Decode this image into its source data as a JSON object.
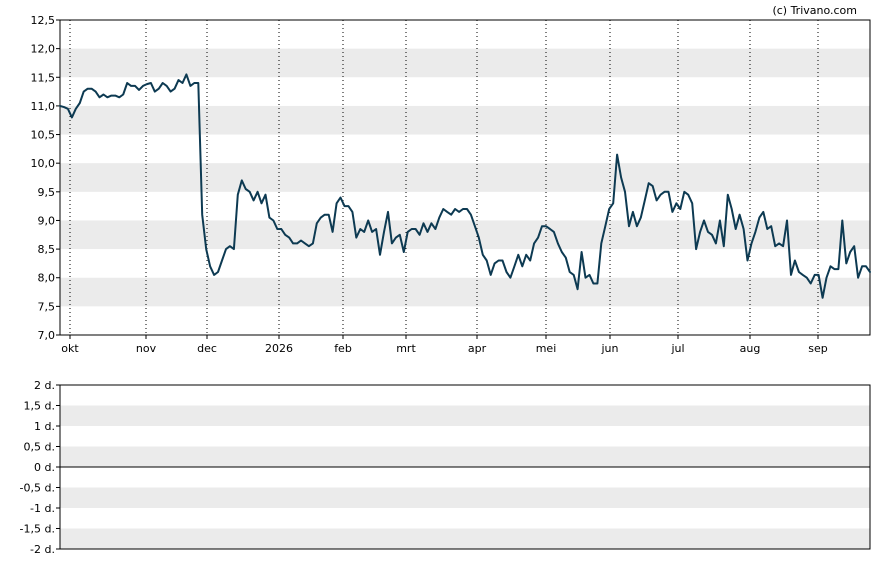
{
  "copyright": "(c) Trivano.com",
  "chart_data": [
    {
      "type": "line",
      "grid": "alternating horizontal bands with dotted vertical month lines",
      "ylim": [
        7.0,
        12.5
      ],
      "yticks": [
        "12,5",
        "12,0",
        "11,5",
        "11,0",
        "10,5",
        "10,0",
        "9,5",
        "9,0",
        "8,5",
        "8,0",
        "7,5",
        "7,0"
      ],
      "xticks": [
        "okt",
        "nov",
        "dec",
        "2026",
        "feb",
        "mrt",
        "apr",
        "mei",
        "jun",
        "jul",
        "aug",
        "sep"
      ],
      "line_color": "#0d3a52",
      "series": [
        {
          "values": [
            11.0,
            10.98,
            10.95,
            10.8,
            10.95,
            11.05,
            11.25,
            11.3,
            11.3,
            11.25,
            11.15,
            11.2,
            11.15,
            11.18,
            11.18,
            11.15,
            11.2,
            11.4,
            11.35,
            11.35,
            11.28,
            11.35,
            11.38,
            11.4,
            11.25,
            11.3,
            11.4,
            11.35,
            11.25,
            11.3,
            11.45,
            11.4,
            11.55,
            11.35,
            11.4,
            11.4,
            9.1,
            8.5,
            8.2,
            8.05,
            8.1,
            8.3,
            8.5,
            8.55,
            8.5,
            9.45,
            9.7,
            9.55,
            9.5,
            9.35,
            9.5,
            9.3,
            9.45,
            9.05,
            9.0,
            8.85,
            8.85,
            8.75,
            8.7,
            8.6,
            8.6,
            8.65,
            8.6,
            8.55,
            8.6,
            8.95,
            9.05,
            9.1,
            9.1,
            8.8,
            9.3,
            9.4,
            9.25,
            9.25,
            9.15,
            8.7,
            8.85,
            8.8,
            9.0,
            8.8,
            8.85,
            8.4,
            8.8,
            9.15,
            8.6,
            8.7,
            8.75,
            8.45,
            8.8,
            8.85,
            8.85,
            8.75,
            8.95,
            8.8,
            8.95,
            8.85,
            9.05,
            9.2,
            9.15,
            9.1,
            9.2,
            9.15,
            9.2,
            9.2,
            9.1,
            8.9,
            8.7,
            8.4,
            8.3,
            8.05,
            8.25,
            8.3,
            8.3,
            8.1,
            8.0,
            8.2,
            8.4,
            8.2,
            8.4,
            8.3,
            8.6,
            8.7,
            8.9,
            8.9,
            8.85,
            8.8,
            8.6,
            8.45,
            8.35,
            8.1,
            8.05,
            7.8,
            8.45,
            8.0,
            8.05,
            7.9,
            7.9,
            8.6,
            8.9,
            9.2,
            9.3,
            10.15,
            9.75,
            9.5,
            8.9,
            9.15,
            8.9,
            9.05,
            9.35,
            9.65,
            9.6,
            9.35,
            9.45,
            9.5,
            9.5,
            9.15,
            9.3,
            9.2,
            9.5,
            9.45,
            9.3,
            8.5,
            8.8,
            9.0,
            8.8,
            8.75,
            8.6,
            9.0,
            8.55,
            9.45,
            9.2,
            8.85,
            9.1,
            8.85,
            8.3,
            8.6,
            8.8,
            9.05,
            9.15,
            8.85,
            8.9,
            8.55,
            8.6,
            8.55,
            9.0,
            8.05,
            8.3,
            8.1,
            8.05,
            8.0,
            7.9,
            8.05,
            8.05,
            7.65,
            8.0,
            8.2,
            8.15,
            8.15,
            9.0,
            8.25,
            8.45,
            8.55,
            8.0,
            8.2,
            8.2,
            8.1
          ]
        }
      ]
    },
    {
      "type": "line",
      "grid": "alternating horizontal bands",
      "ylim": [
        -2,
        2
      ],
      "yticks": [
        "2 d.",
        "1,5 d.",
        "1 d.",
        "0,5 d.",
        "0 d.",
        "-0,5 d.",
        "-1 d.",
        "-1,5 d.",
        "-2 d."
      ],
      "series": [
        {
          "values": []
        }
      ]
    }
  ]
}
